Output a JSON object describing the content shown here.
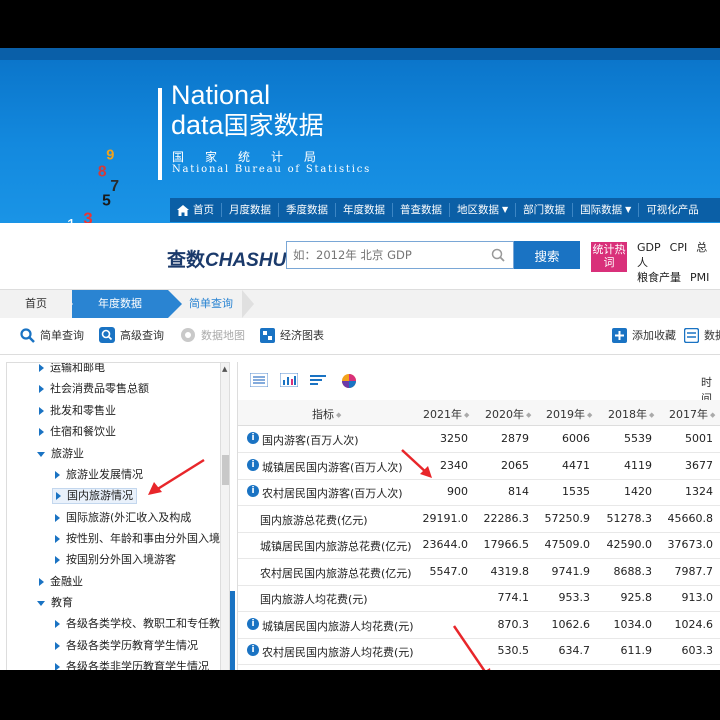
{
  "banner": {
    "brand_en_line1": "National",
    "brand_en_line2_prefix": "data",
    "brand_cn": "国家数据",
    "bureau_cn": "国家统计局",
    "bureau_en": "National Bureau of Statistics",
    "cube_digits": "8 7 5 9 1 3 4 6 2",
    "nav": [
      "首页",
      "月度数据",
      "季度数据",
      "年度数据",
      "普查数据",
      "地区数据",
      "部门数据",
      "国际数据",
      "可视化产品"
    ]
  },
  "search": {
    "logo_text": "查数",
    "logo_en": "CHASHU",
    "placeholder": "如：2012年 北京 GDP",
    "button": "搜索",
    "hot_label": "统计热词",
    "hot_links_row1": [
      "GDP",
      "CPI",
      "总人"
    ],
    "hot_links_row2": [
      "粮食产量",
      "PMI"
    ]
  },
  "breadcrumb": [
    "首页",
    "年度数据",
    "简单查询"
  ],
  "toolbar": {
    "simple_query": "简单查询",
    "advanced_query": "高级查询",
    "data_map": "数据地图",
    "economic_chart": "经济图表",
    "add_favorite": "添加收藏",
    "data": "数据"
  },
  "tree": {
    "items": [
      {
        "label": "运输和邮电",
        "level": 0
      },
      {
        "label": "社会消费品零售总额",
        "level": 0
      },
      {
        "label": "批发和零售业",
        "level": 0
      },
      {
        "label": "住宿和餐饮业",
        "level": 0
      },
      {
        "label": "旅游业",
        "level": 0,
        "expanded": true
      },
      {
        "label": "旅游业发展情况",
        "level": 1
      },
      {
        "label": "国内旅游情况",
        "level": 1,
        "selected": true
      },
      {
        "label": "国际旅游(外汇收入及构成",
        "level": 1
      },
      {
        "label": "按性别、年龄和事由分外国入境",
        "level": 1
      },
      {
        "label": "按国别分外国入境游客",
        "level": 1
      },
      {
        "label": "金融业",
        "level": 0
      },
      {
        "label": "教育",
        "level": 0,
        "expanded": true
      },
      {
        "label": "各级各类学校、教职工和专任教",
        "level": 1
      },
      {
        "label": "各级各类学历教育学生情况",
        "level": 1
      },
      {
        "label": "各级各类非学历教育学生情况",
        "level": 1
      }
    ]
  },
  "table": {
    "time_label": "时间",
    "header": {
      "indicator": "指标",
      "years": [
        "2021年",
        "2020年",
        "2019年",
        "2018年",
        "2017年"
      ]
    },
    "rows": [
      {
        "label": "国内游客(百万人次)",
        "info": true,
        "values": [
          "3250",
          "2879",
          "6006",
          "5539",
          "5001"
        ]
      },
      {
        "label": "城镇居民国内游客(百万人次)",
        "info": true,
        "values": [
          "2340",
          "2065",
          "4471",
          "4119",
          "3677"
        ]
      },
      {
        "label": "农村居民国内游客(百万人次)",
        "info": true,
        "values": [
          "900",
          "814",
          "1535",
          "1420",
          "1324"
        ]
      },
      {
        "label": "国内旅游总花费(亿元)",
        "info": false,
        "values": [
          "29191.0",
          "22286.3",
          "57250.9",
          "51278.3",
          "45660.8"
        ]
      },
      {
        "label": "城镇居民国内旅游总花费(亿元)",
        "info": false,
        "values": [
          "23644.0",
          "17966.5",
          "47509.0",
          "42590.0",
          "37673.0"
        ]
      },
      {
        "label": "农村居民国内旅游总花费(亿元)",
        "info": false,
        "values": [
          "5547.0",
          "4319.8",
          "9741.9",
          "8688.3",
          "7987.7"
        ]
      },
      {
        "label": "国内旅游人均花费(元)",
        "info": false,
        "values": [
          "",
          "774.1",
          "953.3",
          "925.8",
          "913.0"
        ]
      },
      {
        "label": "城镇居民国内旅游人均花费(元)",
        "info": true,
        "values": [
          "",
          "870.3",
          "1062.6",
          "1034.0",
          "1024.6"
        ]
      },
      {
        "label": "农村居民国内旅游人均花费(元)",
        "info": true,
        "values": [
          "",
          "530.5",
          "634.7",
          "611.9",
          "603.3"
        ]
      }
    ]
  },
  "colors": {
    "accent": "#1a73c3",
    "banner": "#1389de",
    "hot": "#d9307a",
    "annotation": "#e8262a"
  }
}
